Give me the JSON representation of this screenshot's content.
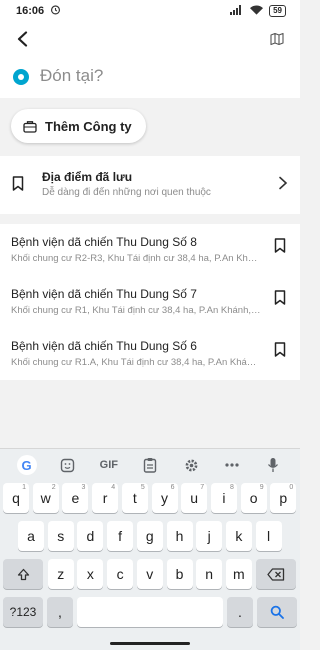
{
  "status_bar": {
    "time": "16:06",
    "battery": "59"
  },
  "pickup": {
    "label": "Đón tại?"
  },
  "chip": {
    "label": "Thêm Công ty"
  },
  "saved": {
    "title": "Địa điểm đã lưu",
    "subtitle": "Dễ dàng đi đến những nơi quen thuộc"
  },
  "results": [
    {
      "title": "Bệnh viện dã chiến Thu Dung Số 8",
      "subtitle": "Khối chung cư R2-R3, Khu Tái định cư 38,4 ha, P.An Khánh, ..."
    },
    {
      "title": "Bệnh viện dã chiến Thu Dung Số 7",
      "subtitle": "Khối chung cư R1, Khu Tái định cư 38,4 ha, P.An Khánh, Q...."
    },
    {
      "title": "Bệnh viện dã chiến Thu Dung Số 6",
      "subtitle": "Khối chung cư R1.A, Khu Tái định cư 38,4 ha, P.An Khánh, ..."
    }
  ],
  "keyboard": {
    "toolbar": [
      "google-icon",
      "sticker-icon",
      "GIF",
      "clipboard-icon",
      "settings-icon",
      "more-icon",
      "mic-icon"
    ],
    "gif_label": "GIF",
    "row1": [
      "q",
      "w",
      "e",
      "r",
      "t",
      "y",
      "u",
      "i",
      "o",
      "p"
    ],
    "row1_hints": [
      "1",
      "2",
      "3",
      "4",
      "5",
      "6",
      "7",
      "8",
      "9",
      "0"
    ],
    "row2": [
      "a",
      "s",
      "d",
      "f",
      "g",
      "h",
      "j",
      "k",
      "l"
    ],
    "row3": [
      "z",
      "x",
      "c",
      "v",
      "b",
      "n",
      "m"
    ],
    "symbols_label": "?123",
    "comma": ",",
    "period": "."
  }
}
